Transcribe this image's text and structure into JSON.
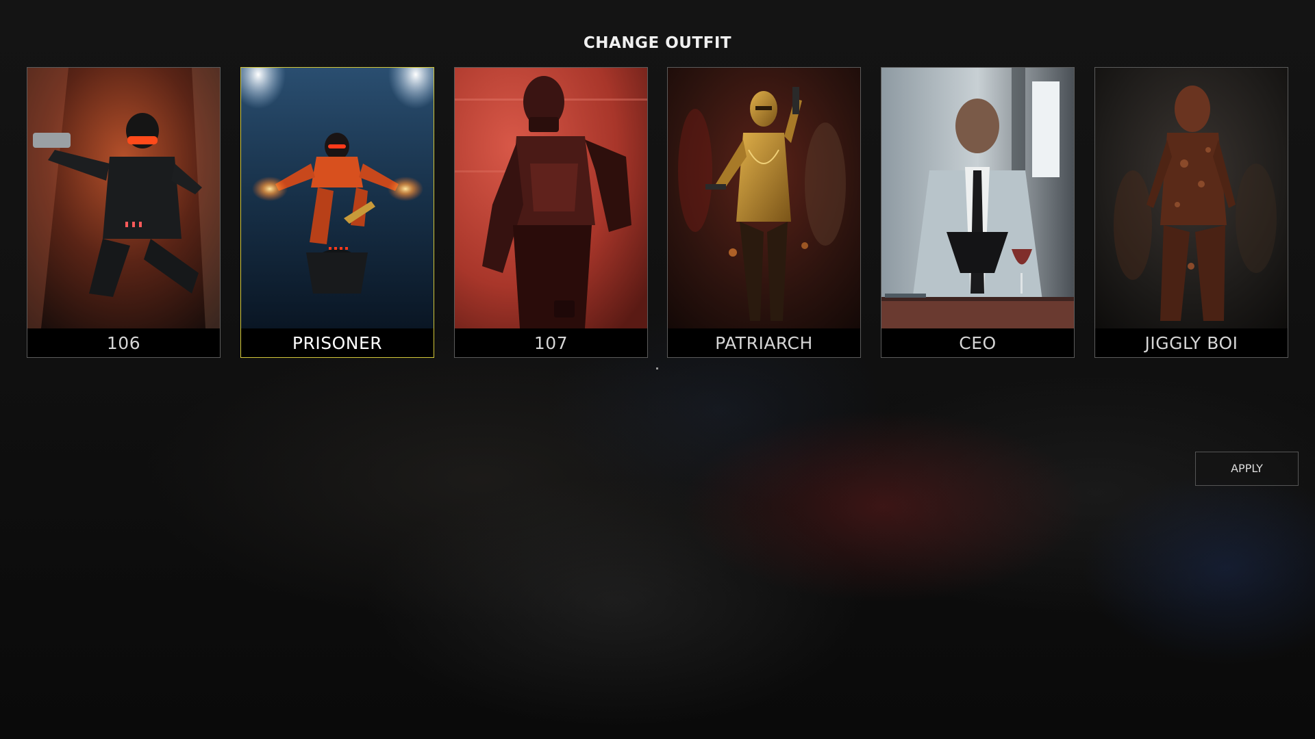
{
  "header": {
    "title": "CHANGE OUTFIT"
  },
  "outfits": [
    {
      "label": "106",
      "selected": false,
      "palette": [
        "#8a3a22",
        "#2a1712",
        "#141414"
      ],
      "accent": "#ff4a1a"
    },
    {
      "label": "PRISONER",
      "selected": true,
      "palette": [
        "#c8d8e8",
        "#1e3a56",
        "#0a1422"
      ],
      "accent": "#ff5a1a"
    },
    {
      "label": "107",
      "selected": false,
      "palette": [
        "#c84838",
        "#8e2a22",
        "#3a1010"
      ],
      "accent": "#ff5a40"
    },
    {
      "label": "PATRIARCH",
      "selected": false,
      "palette": [
        "#4a1a14",
        "#2a1410",
        "#120a08"
      ],
      "accent": "#c8962a"
    },
    {
      "label": "CEO",
      "selected": false,
      "palette": [
        "#d8dde0",
        "#7a8a92",
        "#3a4a52"
      ],
      "accent": "#8e3a2a"
    },
    {
      "label": "JIGGLY BOI",
      "selected": false,
      "palette": [
        "#2a2624",
        "#1a1816",
        "#0e0c0c"
      ],
      "accent": "#8a4a2a"
    }
  ],
  "actions": {
    "apply_label": "APPLY"
  },
  "colors": {
    "selected_border": "#d4c93a",
    "card_border": "#5c5c5c"
  }
}
